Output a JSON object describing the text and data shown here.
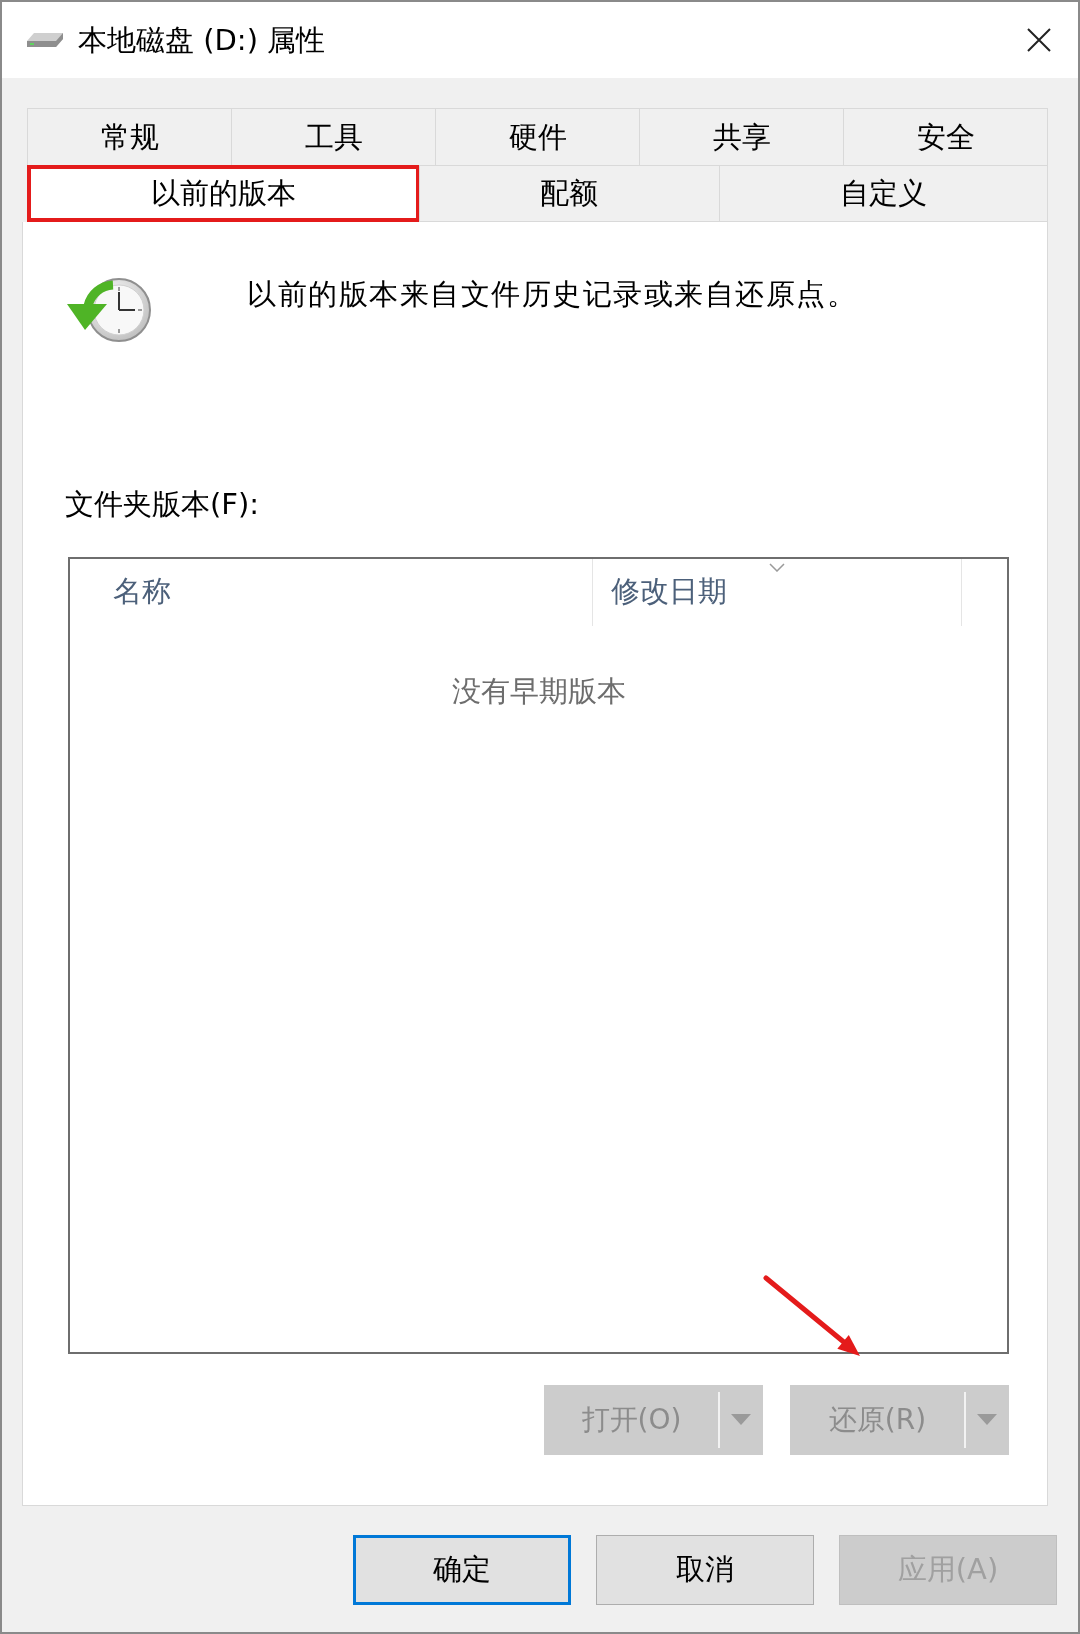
{
  "window": {
    "title": "本地磁盘 (D:) 属性"
  },
  "tab_rows": [
    {
      "tabs": [
        {
          "label": "常规",
          "selected": false,
          "highlighted": false
        },
        {
          "label": "工具",
          "selected": false,
          "highlighted": false
        },
        {
          "label": "硬件",
          "selected": false,
          "highlighted": false
        },
        {
          "label": "共享",
          "selected": false,
          "highlighted": false
        },
        {
          "label": "安全",
          "selected": false,
          "highlighted": false
        }
      ]
    },
    {
      "tabs": [
        {
          "label": "以前的版本",
          "selected": true,
          "highlighted": true
        },
        {
          "label": "配额",
          "selected": false,
          "highlighted": false
        },
        {
          "label": "自定义",
          "selected": false,
          "highlighted": false
        }
      ]
    }
  ],
  "panel": {
    "description": "以前的版本来自文件历史记录或来自还原点。",
    "list_label": "文件夹版本(F):",
    "versions_list": {
      "columns": [
        {
          "label": "名称",
          "sorted": false
        },
        {
          "label": "修改日期",
          "sorted": true
        }
      ],
      "empty_message": "没有早期版本"
    },
    "split_buttons": [
      {
        "label": "打开(O)",
        "disabled": true,
        "pointed_at": false
      },
      {
        "label": "还原(R)",
        "disabled": true,
        "pointed_at": true
      }
    ]
  },
  "buttons": [
    {
      "label": "确定",
      "default": true,
      "disabled": false
    },
    {
      "label": "取消",
      "default": false,
      "disabled": false
    },
    {
      "label": "应用(A)",
      "default": false,
      "disabled": true
    }
  ]
}
